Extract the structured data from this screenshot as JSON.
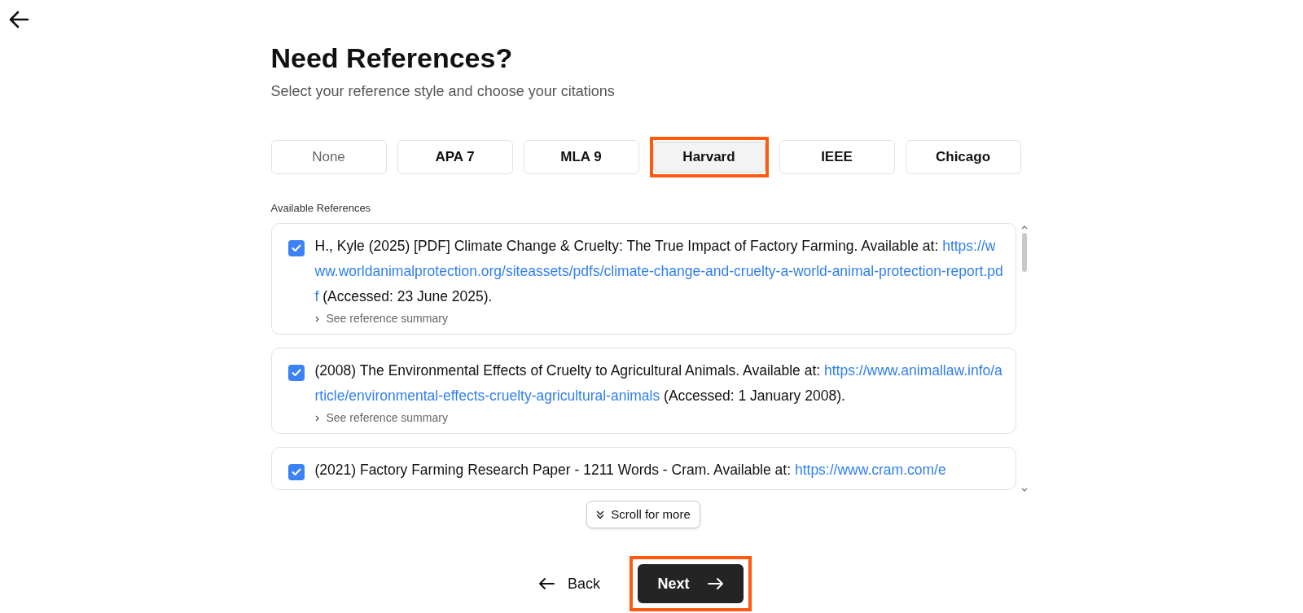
{
  "title": "Need References?",
  "subtitle": "Select your reference style and choose your citations",
  "styles": [
    {
      "label": "None",
      "selected": false,
      "disabled": true,
      "highlighted": false
    },
    {
      "label": "APA 7",
      "selected": false,
      "disabled": false,
      "highlighted": false
    },
    {
      "label": "MLA 9",
      "selected": false,
      "disabled": false,
      "highlighted": false
    },
    {
      "label": "Harvard",
      "selected": true,
      "disabled": false,
      "highlighted": true
    },
    {
      "label": "IEEE",
      "selected": false,
      "disabled": false,
      "highlighted": false
    },
    {
      "label": "Chicago",
      "selected": false,
      "disabled": false,
      "highlighted": false
    }
  ],
  "references_label": "Available References",
  "references": [
    {
      "checked": true,
      "text": "H., Kyle (2025) [PDF] Climate Change & Cruelty: The True Impact of Factory Farming. Available at: ",
      "url": "https://www.worldanimalprotection.org/siteassets/pdfs/climate-change-and-cruelty-a-world-animal-protection-report.pdf",
      "after": " (Accessed: 23 June 2025).",
      "summary": "See reference summary"
    },
    {
      "checked": true,
      "text": "(2008) The Environmental Effects of Cruelty to Agricultural Animals. Available at: ",
      "url": "https://www.animallaw.info/article/environmental-effects-cruelty-agricultural-animals",
      "after": " (Accessed: 1 January 2008).",
      "summary": "See reference summary"
    },
    {
      "checked": true,
      "text": "(2021) Factory Farming Research Paper - 1211 Words - Cram. Available at: ",
      "url": "https://www.cram.com/e"
    }
  ],
  "scroll_hint": "Scroll for more",
  "back": {
    "label": "Back"
  },
  "next": {
    "label": "Next",
    "highlighted": true
  }
}
